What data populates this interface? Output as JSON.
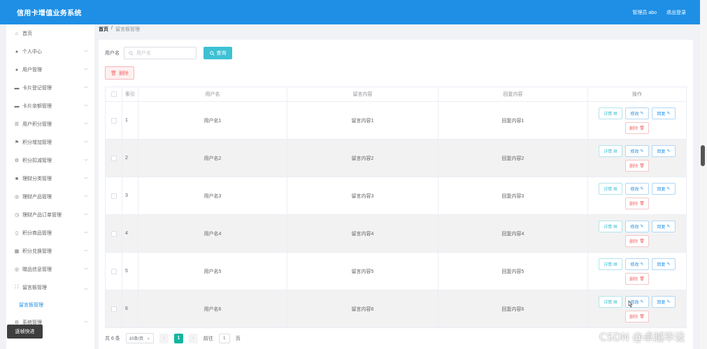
{
  "header": {
    "title": "信用卡增值业务系统",
    "user_label": "管理员 abo",
    "logout_label": "退出登录"
  },
  "sidebar": {
    "items": [
      {
        "label": "首页",
        "icon": "home-icon"
      },
      {
        "label": "个人中心",
        "icon": "user-icon"
      },
      {
        "label": "用户管理",
        "icon": "user-icon"
      },
      {
        "label": "卡片登记管理",
        "icon": "card-icon"
      },
      {
        "label": "卡片余额管理",
        "icon": "card-icon"
      },
      {
        "label": "用户积分管理",
        "icon": "list-icon"
      },
      {
        "label": "积分增加管理",
        "icon": "flag-icon"
      },
      {
        "label": "积分扣减管理",
        "icon": "gear-icon"
      },
      {
        "label": "理财分类管理",
        "icon": "box-icon"
      },
      {
        "label": "理财产品管理",
        "icon": "circle-icon"
      },
      {
        "label": "理财产品订单管理",
        "icon": "clock-icon"
      },
      {
        "label": "积分商品管理",
        "icon": "bag-icon"
      },
      {
        "label": "积分兑换管理",
        "icon": "grid-icon"
      },
      {
        "label": "赠品信息管理",
        "icon": "circle-icon"
      },
      {
        "label": "留言板管理",
        "icon": "message-icon"
      }
    ],
    "sub_item": "留言板管理",
    "last_item": "系统管理",
    "quick_button": "逐帧快进"
  },
  "breadcrumb": {
    "home": "首页",
    "sep": "/",
    "current": "留言板管理"
  },
  "search": {
    "label": "用户名",
    "placeholder": "用户名",
    "button": "查询"
  },
  "toolbar": {
    "delete_label": "删除"
  },
  "table": {
    "headers": {
      "index": "索引",
      "username": "用户名",
      "message": "留言内容",
      "reply": "回复内容",
      "ops": "操作"
    },
    "rows": [
      {
        "index": "1",
        "username": "用户名1",
        "message": "留言内容1",
        "reply": "回复内容1"
      },
      {
        "index": "2",
        "username": "用户名2",
        "message": "留言内容2",
        "reply": "回复内容2"
      },
      {
        "index": "3",
        "username": "用户名3",
        "message": "留言内容3",
        "reply": "回复内容3"
      },
      {
        "index": "4",
        "username": "用户名4",
        "message": "留言内容4",
        "reply": "回复内容4"
      },
      {
        "index": "5",
        "username": "用户名5",
        "message": "留言内容5",
        "reply": "回复内容5"
      },
      {
        "index": "6",
        "username": "用户名6",
        "message": "留言内容6",
        "reply": "回复内容6"
      }
    ],
    "ops": {
      "detail": "详情",
      "edit": "修改",
      "reply": "回复",
      "delete": "删除"
    }
  },
  "pager": {
    "total": "共 6 条",
    "page_size": "10条/页",
    "current_page": "1",
    "goto_label": "前往",
    "goto_value": "1",
    "page_unit": "页"
  },
  "watermark": "CSDN @卓越毕设",
  "colors": {
    "header_bg": "#1e8fe5",
    "search_btn": "#3ec1d3",
    "active_page": "#13b5a0",
    "danger": "#f56c6c"
  }
}
